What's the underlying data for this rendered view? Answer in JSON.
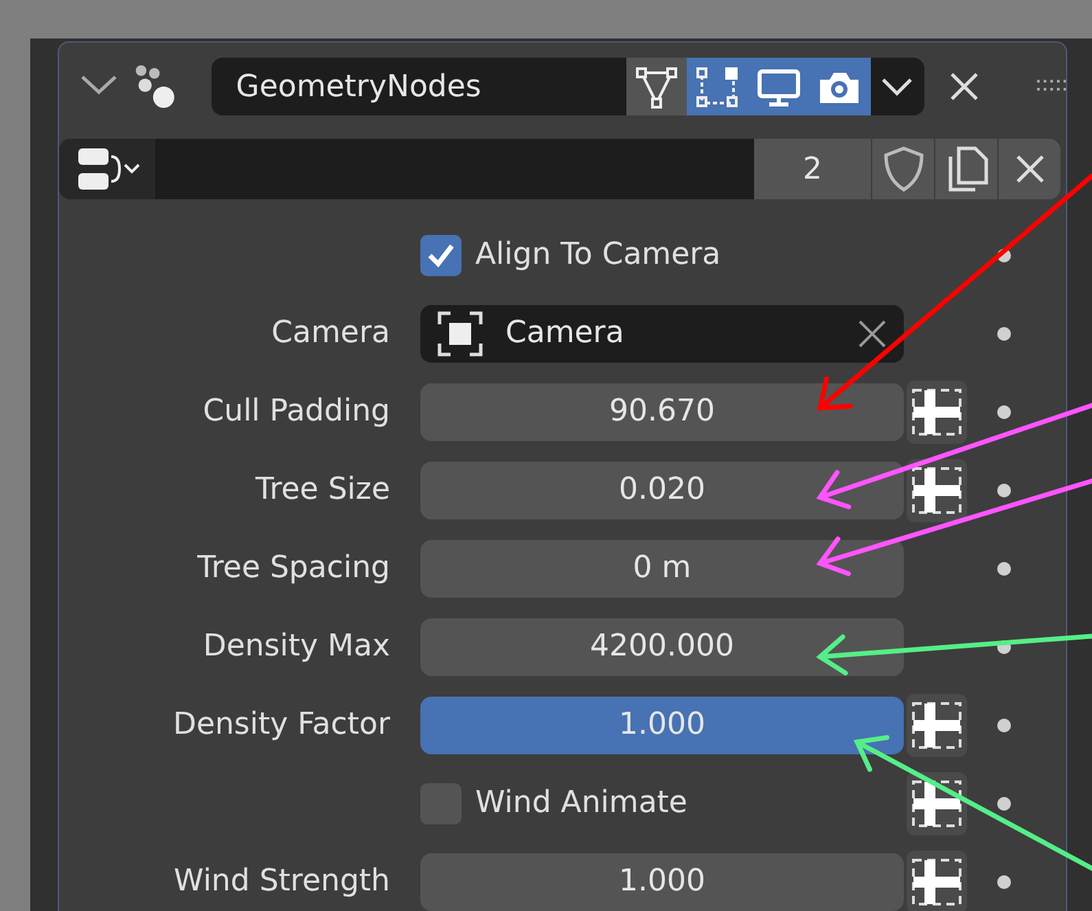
{
  "modifier": {
    "expanded": true,
    "name": "GeometryNodes",
    "toggles": [
      {
        "kind": "cage",
        "selected": false
      },
      {
        "kind": "editmode",
        "selected": true
      },
      {
        "kind": "viewport",
        "selected": true
      },
      {
        "kind": "render",
        "selected": true
      }
    ]
  },
  "node_group": {
    "users": "2"
  },
  "rows": [
    {
      "kind": "checkbox",
      "label": "Align To Camera",
      "checked": true,
      "attribute_toggle": false
    },
    {
      "kind": "object",
      "label": "Camera",
      "value": "Camera"
    },
    {
      "kind": "number",
      "label": "Cull Padding",
      "value": "90.670",
      "selected": false,
      "attribute_toggle": true
    },
    {
      "kind": "number",
      "label": "Tree Size",
      "value": "0.020",
      "selected": false,
      "attribute_toggle": true
    },
    {
      "kind": "number",
      "label": "Tree Spacing",
      "value": "0 m",
      "selected": false,
      "attribute_toggle": false
    },
    {
      "kind": "number",
      "label": "Density Max",
      "value": "4200.000",
      "selected": false,
      "attribute_toggle": false
    },
    {
      "kind": "number",
      "label": "Density Factor",
      "value": "1.000",
      "selected": true,
      "attribute_toggle": true
    },
    {
      "kind": "checkbox",
      "label": "Wind Animate",
      "checked": false,
      "attribute_toggle": true
    },
    {
      "kind": "number",
      "label": "Wind Strength",
      "value": "1.000",
      "selected": false,
      "attribute_toggle": true
    }
  ],
  "annotations": [
    {
      "color": "#ff0000"
    },
    {
      "color": "#ff55ff"
    },
    {
      "color": "#ff55ff"
    },
    {
      "color": "#55ee88"
    },
    {
      "color": "#55ee88"
    }
  ]
}
